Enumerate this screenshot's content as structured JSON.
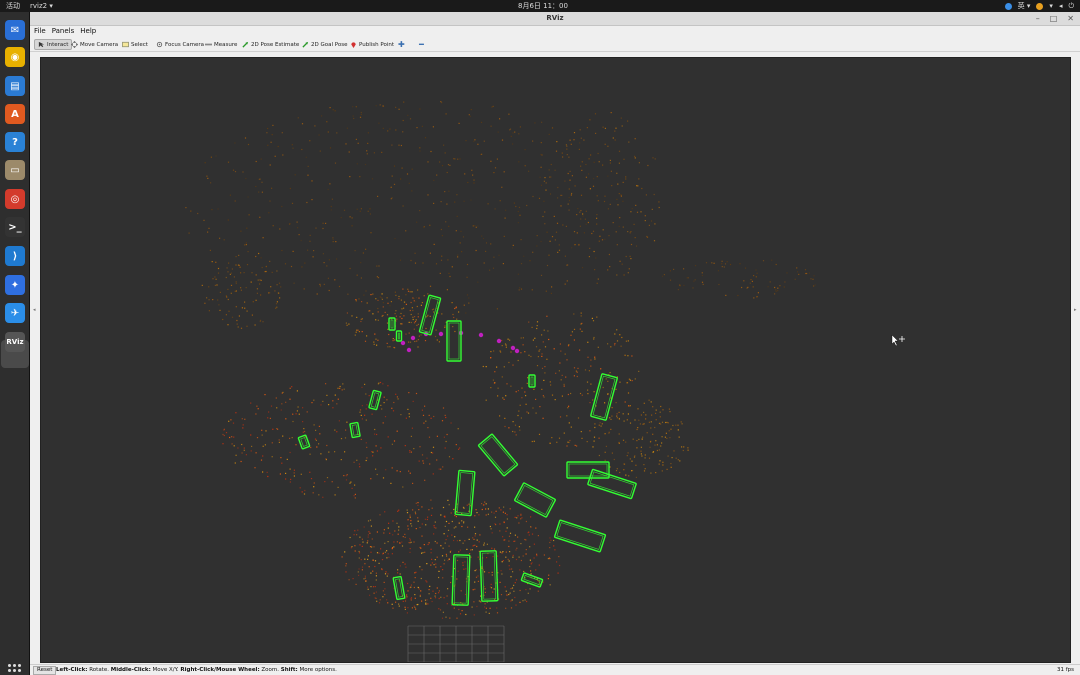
{
  "topbar": {
    "activities": "活动",
    "app_menu": "rviz2 ▾",
    "clock": "8月6日  11：00",
    "lang": "英 ▾"
  },
  "dock": {
    "items": [
      {
        "name": "thunderbird-icon",
        "color": "#2a6fd6",
        "glyph": "✉"
      },
      {
        "name": "rhythmbox-icon",
        "color": "#e8b100",
        "glyph": "◉"
      },
      {
        "name": "writer-icon",
        "color": "#2b7bd3",
        "glyph": "▤"
      },
      {
        "name": "software-center-icon",
        "color": "#e05a20",
        "glyph": "A"
      },
      {
        "name": "help-icon",
        "color": "#2a82d6",
        "glyph": "?"
      },
      {
        "name": "files-icon",
        "color": "#9c8a6a",
        "glyph": "▭"
      },
      {
        "name": "chrome-icon",
        "color": "#d33b2c",
        "glyph": "◎"
      },
      {
        "name": "terminal-icon",
        "color": "#333333",
        "glyph": ">_"
      },
      {
        "name": "vscode-icon",
        "color": "#1f7ad0",
        "glyph": "⟩"
      },
      {
        "name": "feishu-icon",
        "color": "#2f6fe0",
        "glyph": "✦"
      },
      {
        "name": "lark-icon",
        "color": "#2b8ee8",
        "glyph": "✈"
      },
      {
        "name": "rviz-icon",
        "color": "#555555",
        "glyph": "RViz"
      }
    ]
  },
  "window": {
    "title": "RViz",
    "controls": [
      "–",
      "□",
      "✕"
    ]
  },
  "menubar": [
    "File",
    "Panels",
    "Help"
  ],
  "toolbar": {
    "interact": "Interact",
    "move_camera": "Move Camera",
    "select": "Select",
    "focus_camera": "Focus Camera",
    "measure": "Measure",
    "pose_estimate": "2D Pose Estimate",
    "goal_pose": "2D Goal Pose",
    "publish_point": "Publish Point",
    "plus": "✚",
    "minus": "━"
  },
  "viewport": {
    "background": "#303030",
    "box_color": "#33ff33",
    "marker_color": "#c020c0"
  },
  "statusbar": {
    "reset": "Reset",
    "help_left_click": "Left-Click:",
    "help_rotate": " Rotate. ",
    "help_middle_click": "Middle-Click:",
    "help_move": " Move X/Y. ",
    "help_right_click": "Right-Click/Mouse Wheel:",
    "help_zoom": " Zoom. ",
    "help_shift": "Shift:",
    "help_more": " More options.",
    "fps": "31 fps"
  }
}
